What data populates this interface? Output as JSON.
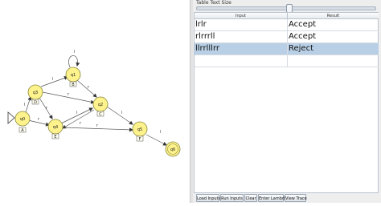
{
  "automaton": {
    "states": [
      {
        "name": "q0",
        "tag": "A",
        "initial": true,
        "final": false
      },
      {
        "name": "q1",
        "tag": "B",
        "initial": false,
        "final": false
      },
      {
        "name": "q2",
        "tag": "C",
        "initial": false,
        "final": false
      },
      {
        "name": "q3",
        "tag": "D",
        "initial": false,
        "final": false
      },
      {
        "name": "q4",
        "tag": "E",
        "initial": false,
        "final": false
      },
      {
        "name": "q5",
        "tag": "F",
        "initial": false,
        "final": false
      },
      {
        "name": "q6",
        "tag": "",
        "initial": false,
        "final": true
      }
    ],
    "transition_symbol_l": "l",
    "transition_symbol_r": "r",
    "state_color": "#fdf28c",
    "state_border": "#8a8a3c"
  },
  "panel": {
    "size_label": "Table Text Size",
    "col_input": "Input",
    "col_result": "Result",
    "rows": [
      {
        "input": "lrlr",
        "result": "Accept",
        "selected": false
      },
      {
        "input": "rlrrrll",
        "result": "Accept",
        "selected": false
      },
      {
        "input": "llrrlllrr",
        "result": "Reject",
        "selected": true
      },
      {
        "input": "",
        "result": "",
        "selected": false
      }
    ],
    "selected_color": "#b8cfe5"
  },
  "buttons": {
    "load": "Load Inputs",
    "run": "Run Inputs",
    "clear": "Clear",
    "lambda": "Enter Lambda",
    "trace": "View Trace"
  }
}
